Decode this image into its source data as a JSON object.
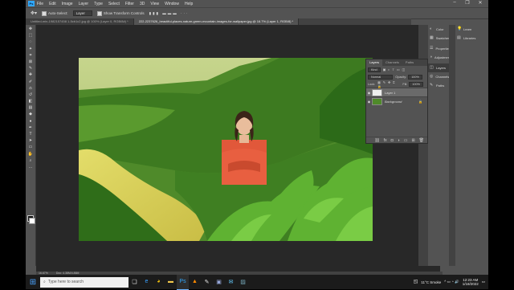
{
  "app": {
    "logo": "Ps"
  },
  "menu": [
    "File",
    "Edit",
    "Image",
    "Layer",
    "Type",
    "Select",
    "Filter",
    "3D",
    "View",
    "Window",
    "Help"
  ],
  "window_controls": [
    "–",
    "❐",
    "✕"
  ],
  "options": {
    "auto_select_label": "Auto-Select:",
    "auto_select_value": "Layer",
    "transform_label": "Show Transform Controls"
  },
  "tabs": [
    {
      "label": "Untitled-min-1982157458 1-5cb1c2.jpg @ 100% (Layer 0, RGB/8#) *"
    },
    {
      "label": "222-2237626_beautiful-places-nature-green-mountain-images-for-wallpaper.jpg @ 16.7% (Layer 1, RGB/8) *"
    }
  ],
  "tools": [
    "move-icon",
    "marquee-icon",
    "lasso-icon",
    "magic-wand-icon",
    "crop-icon",
    "frame-icon",
    "eyedropper-icon",
    "healing-icon",
    "brush-icon",
    "stamp-icon",
    "history-brush-icon",
    "eraser-icon",
    "gradient-icon",
    "blur-icon",
    "dodge-icon",
    "pen-icon",
    "type-icon",
    "path-select-icon",
    "rectangle-icon",
    "hand-icon",
    "zoom-icon",
    "more-icon"
  ],
  "status": {
    "zoom": "16.67%",
    "doc": "Doc: 4.38M/4.86M"
  },
  "panels_col1": [
    {
      "icon": "color-icon",
      "label": "Color"
    },
    {
      "icon": "swatches-icon",
      "label": "Swatches"
    },
    {
      "icon": "properties-icon",
      "label": "Properties"
    },
    {
      "icon": "adjustments-icon",
      "label": "Adjustments"
    },
    {
      "icon": "layers-icon",
      "label": "Layers"
    },
    {
      "icon": "channels-icon",
      "label": "Channels"
    },
    {
      "icon": "paths-icon",
      "label": "Paths"
    }
  ],
  "panels_col2": [
    {
      "icon": "learn-icon",
      "label": "Learn"
    },
    {
      "icon": "libraries-icon",
      "label": "Libraries"
    }
  ],
  "layers_panel": {
    "tabs": [
      "Layers",
      "Channels",
      "Paths"
    ],
    "kind": "Kind",
    "blend": "Normal",
    "opacity_label": "Opacity:",
    "opacity": "100%",
    "lock_label": "Lock:",
    "fill_label": "Fill:",
    "fill": "100%",
    "layers": [
      {
        "name": "Layer 1",
        "selected": true
      },
      {
        "name": "Background",
        "selected": false
      }
    ]
  },
  "taskbar": {
    "search_placeholder": "Type here to search",
    "apps": [
      "task-view-icon",
      "edge-icon",
      "chrome-icon",
      "explorer-icon",
      "photoshop-icon",
      "vlc-icon",
      "paint-icon",
      "store-icon",
      "mail-icon",
      "photos-icon"
    ],
    "weather": "11°C  Smoke",
    "time": "12:23 AM",
    "date": "1/18/2022"
  }
}
